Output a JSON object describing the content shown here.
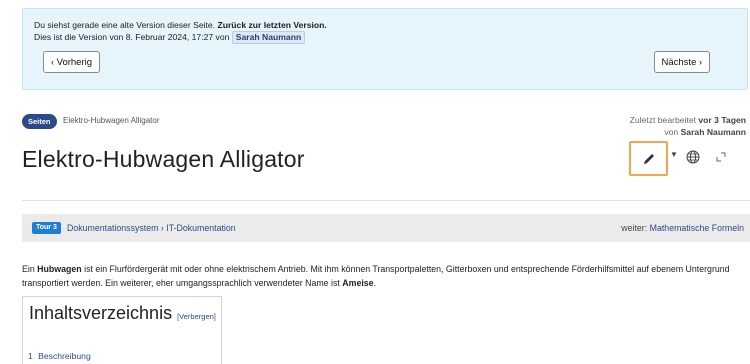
{
  "notice": {
    "line1_prefix": "Du siehst gerade eine alte Version dieser Seite.",
    "line1_link": "Zurück zur letzten Version.",
    "line2_prefix": "Dies ist die Version von 8. Februar 2024, 17:27 von",
    "line2_author": "Sarah Naumann",
    "prev_label": "Vorherig",
    "next_label": "Nächste"
  },
  "page": {
    "badge": "Seiten",
    "breadcrumb": "Elektro-Hubwagen Alligator",
    "title": "Elektro-Hubwagen Alligator",
    "edited_prefix": "Zuletzt bearbeitet",
    "edited_time": "vor 3 Tagen",
    "edited_by_prefix": "von",
    "edited_by": "Sarah Naumann"
  },
  "tour": {
    "badge": "Tour 3",
    "path": "Dokumentationssystem › IT-Dokumentation",
    "next_prefix": "weiter:",
    "next_link": "Mathematische Formeln"
  },
  "intro": {
    "t1": "Ein",
    "b1": "Hubwagen",
    "t2": "ist ein Flurfördergerät mit oder ohne elektrischem Antrieb. Mit ihm können Transportpaletten, Gitterboxen und entsprechende Förderhilfsmittel auf ebenem Untergrund transportiert werden. Ein weiterer, eher umgangssprachlich verwendeter Name ist",
    "b2": "Ameise",
    "t3": "."
  },
  "toc": {
    "title": "Inhaltsverzeichnis",
    "hide_label": "[Verbergen]",
    "items": [
      {
        "num": "1",
        "label": "Beschreibung"
      }
    ]
  },
  "colors": {
    "notice_bg": "#e6f4fb",
    "badge_bg": "#2c4a8a",
    "tour_badge_bg": "#1f7fd7",
    "edit_highlight": "#f4a64d",
    "link": "#2f4a86"
  },
  "icons": [
    "chevron-left-icon",
    "chevron-right-icon",
    "pencil-icon",
    "caret-down-icon",
    "globe-icon",
    "expand-icon"
  ]
}
